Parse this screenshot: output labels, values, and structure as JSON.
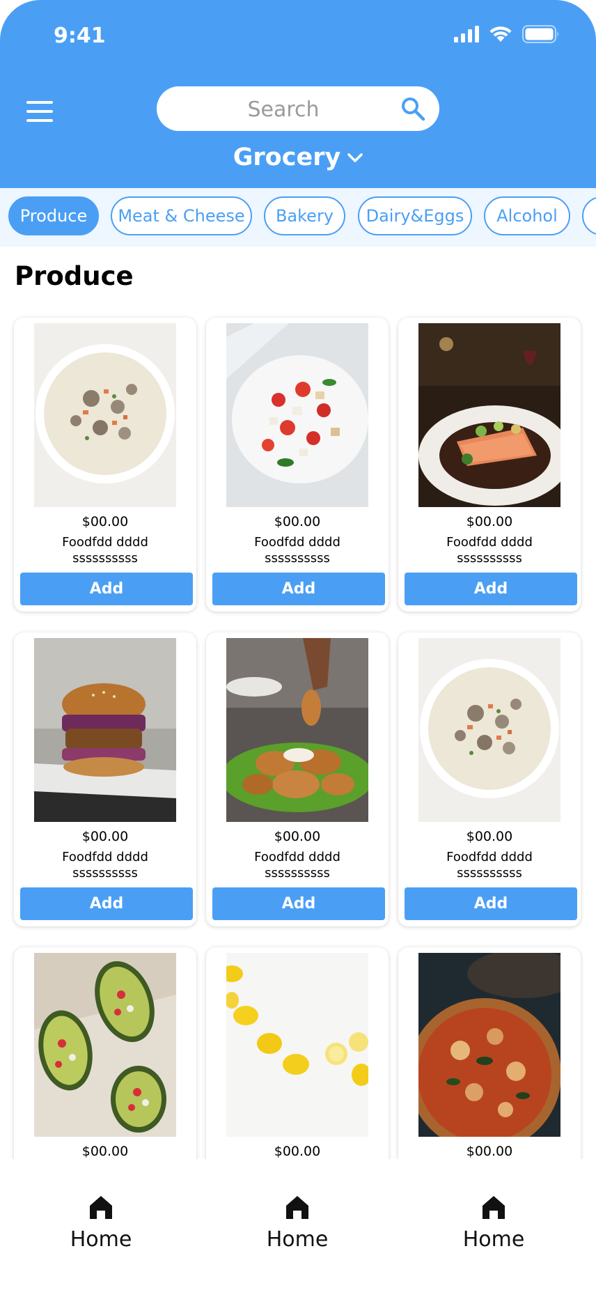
{
  "status_bar": {
    "time": "9:41"
  },
  "header": {
    "search_placeholder": "Search",
    "store_label": "Grocery",
    "accent_color": "#4a9ff5"
  },
  "categories": [
    "Produce",
    "Meat & Cheese",
    "Bakery",
    "Dairy&Eggs",
    "Alcohol"
  ],
  "active_category": "Produce",
  "section_title": "Produce",
  "products": [
    {
      "price": "$00.00",
      "name": "Foodfdd dddd",
      "subtitle": "ssssssssss",
      "add_label": "Add",
      "image": "clam-chowder"
    },
    {
      "price": "$00.00",
      "name": "Foodfdd dddd",
      "subtitle": "ssssssssss",
      "add_label": "Add",
      "image": "tomato-salad"
    },
    {
      "price": "$00.00",
      "name": "Foodfdd dddd",
      "subtitle": "ssssssssss",
      "add_label": "Add",
      "image": "salmon-plate"
    },
    {
      "price": "$00.00",
      "name": "Foodfdd dddd",
      "subtitle": "ssssssssss",
      "add_label": "Add",
      "image": "burger"
    },
    {
      "price": "$00.00",
      "name": "Foodfdd dddd",
      "subtitle": "ssssssssss",
      "add_label": "Add",
      "image": "fried-chicken"
    },
    {
      "price": "$00.00",
      "name": "Foodfdd dddd",
      "subtitle": "ssssssssss",
      "add_label": "Add",
      "image": "clam-chowder"
    },
    {
      "price": "$00.00",
      "image": "stuffed-avocado"
    },
    {
      "price": "$00.00",
      "image": "lemons"
    },
    {
      "price": "$00.00",
      "image": "pizza"
    }
  ],
  "tabbar": [
    {
      "label": "Home",
      "icon": "home-icon"
    },
    {
      "label": "Home",
      "icon": "home-icon"
    },
    {
      "label": "Home",
      "icon": "home-icon"
    }
  ]
}
